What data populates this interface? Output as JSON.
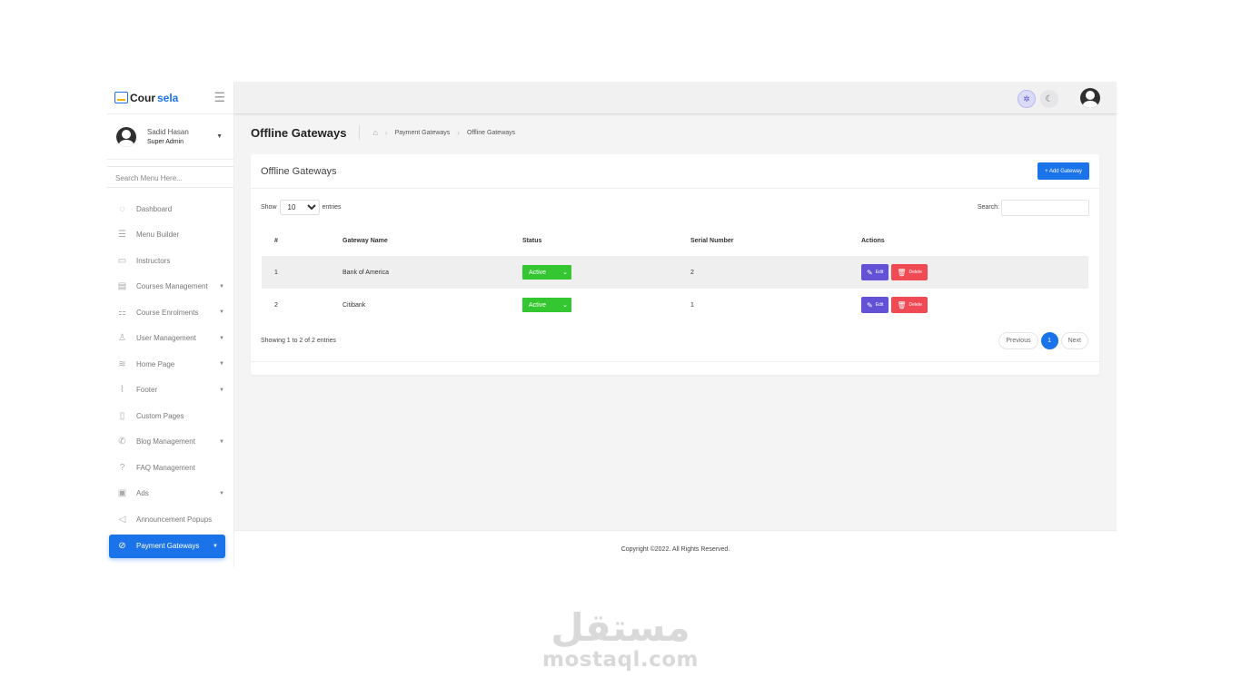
{
  "brand": {
    "name_part1": "Cour",
    "name_part2": "sela",
    "accent_color": "#1a73e8"
  },
  "profile": {
    "name": "Sadid Hasan",
    "role": "Super Admin"
  },
  "sidebar": {
    "search_placeholder": "Search Menu Here...",
    "items": [
      {
        "label": "Dashboard",
        "icon": "palette-icon",
        "has_caret": false
      },
      {
        "label": "Menu Builder",
        "icon": "bars-icon",
        "has_caret": false
      },
      {
        "label": "Instructors",
        "icon": "chalkboard-teacher-icon",
        "has_caret": false
      },
      {
        "label": "Courses Management",
        "icon": "book-icon",
        "has_caret": true
      },
      {
        "label": "Course Enrolments",
        "icon": "users-class-icon",
        "has_caret": true
      },
      {
        "label": "User Management",
        "icon": "users-icon",
        "has_caret": true
      },
      {
        "label": "Home Page",
        "icon": "layers-icon",
        "has_caret": true
      },
      {
        "label": "Footer",
        "icon": "shoe-icon",
        "has_caret": true
      },
      {
        "label": "Custom Pages",
        "icon": "file-icon",
        "has_caret": false
      },
      {
        "label": "Blog Management",
        "icon": "blog-icon",
        "has_caret": true
      },
      {
        "label": "FAQ Management",
        "icon": "question-circle-icon",
        "has_caret": false
      },
      {
        "label": "Ads",
        "icon": "ad-icon",
        "has_caret": true
      },
      {
        "label": "Announcement Popups",
        "icon": "bullhorn-icon",
        "has_caret": false
      },
      {
        "label": "Payment Gateways",
        "icon": "money-icon",
        "has_caret": true,
        "active": true
      }
    ]
  },
  "header": {
    "title": "Offline Gateways",
    "breadcrumb": [
      "Payment Gateways",
      "Offline Gateways"
    ]
  },
  "card": {
    "title": "Offline Gateways",
    "add_button": "+ Add Gateway",
    "show_label": "Show",
    "entries_label": "entries",
    "page_size": "10",
    "search_label": "Search:",
    "columns": [
      "#",
      "Gateway Name",
      "Status",
      "Serial Number",
      "Actions"
    ],
    "rows": [
      {
        "num": "1",
        "name": "Bank of America",
        "status": "Active",
        "serial": "2"
      },
      {
        "num": "2",
        "name": "Citibank",
        "status": "Active",
        "serial": "1"
      }
    ],
    "edit_label": "Edit",
    "delete_label": "Delete",
    "info": "Showing 1 to 2 of 2 entries",
    "pager": {
      "previous": "Previous",
      "current": "1",
      "next": "Next"
    }
  },
  "footer": {
    "copyright": "Copyright ©2022. All Rights Reserved."
  },
  "watermark": {
    "arabic": "مستقل",
    "latin": "mostaql.com"
  },
  "colors": {
    "primary": "#1a73e8",
    "status_active": "#34c732",
    "edit": "#6352d6",
    "delete": "#f04a55"
  }
}
